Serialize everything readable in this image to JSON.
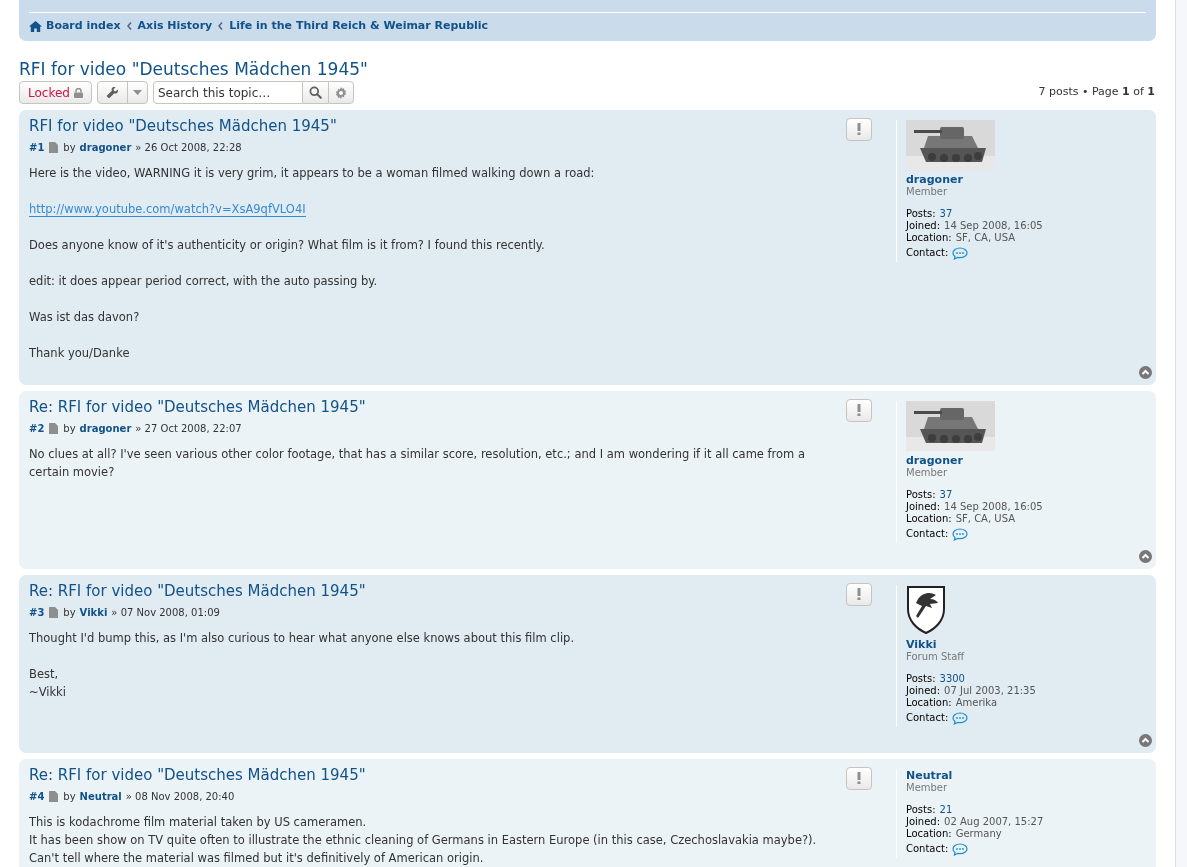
{
  "breadcrumbs": [
    {
      "label": "Board index",
      "icon": true
    },
    {
      "label": "Axis History",
      "icon": false
    },
    {
      "label": "Life in the Third Reich & Weimar Republic",
      "icon": false
    }
  ],
  "topic": {
    "title": "RFI for video \"Deutsches Mädchen 1945\"",
    "locked_label": "Locked",
    "search_placeholder": "Search this topic…",
    "pagination": "7 posts • Page **1** of **1**"
  },
  "posts": [
    {
      "title": "RFI for video \"Deutsches Mädchen 1945\"",
      "number": "#1",
      "by": "by",
      "author": "dragoner",
      "date": "» 26 Oct 2008, 22:28",
      "body": [
        {
          "kind": "text",
          "text": "Here is the video, WARNING it is very grim, it appears to be a woman filmed walking down a road:"
        },
        {
          "kind": "link",
          "text": "http://www.youtube.com/watch?v=XsA9qfVLO4I"
        },
        {
          "kind": "text",
          "text": "Does anyone know of it's authenticity or origin? What film is it from? I found this recently."
        },
        {
          "kind": "text",
          "text": "edit: it does appear period correct, with the auto passing by."
        },
        {
          "kind": "text",
          "text": "Was ist das davon?"
        },
        {
          "kind": "text",
          "text": "Thank you/Danke"
        }
      ],
      "avatar": {
        "kind": "picture"
      },
      "username": "dragoner",
      "rank": "Member",
      "posts_label": "Posts:",
      "posts": "37",
      "joined_label": "Joined:",
      "joined": "14 Sep 2008, 16:05",
      "location_label": "Location:",
      "location": "SF, CA, USA",
      "contact_label": "Contact:"
    },
    {
      "title": "Re: RFI for video \"Deutsches Mädchen 1945\"",
      "number": "#2",
      "by": "by",
      "author": "dragoner",
      "date": "» 27 Oct 2008, 22:07",
      "body": [
        {
          "kind": "text",
          "text": "No clues at all? I've seen various other color footage, that has a similar score, resolution, etc.; and I am wondering if it all came from a certain movie?"
        }
      ],
      "avatar": {
        "kind": "picture"
      },
      "username": "dragoner",
      "rank": "Member",
      "posts_label": "Posts:",
      "posts": "37",
      "joined_label": "Joined:",
      "joined": "14 Sep 2008, 16:05",
      "location_label": "Location:",
      "location": "SF, CA, USA",
      "contact_label": "Contact:"
    },
    {
      "title": "Re: RFI for video \"Deutsches Mädchen 1945\"",
      "number": "#3",
      "by": "by",
      "author": "Vikki",
      "date": "» 07 Nov 2008, 01:09",
      "body": [
        {
          "kind": "text",
          "text": "Thought I'd bump this, as I'm also curious to hear what anyone else knows about this film clip."
        },
        {
          "kind": "lines",
          "lines": [
            "Best,",
            "~Vikki"
          ]
        }
      ],
      "avatar": {
        "kind": "emblem"
      },
      "username": "Vikki",
      "rank": "Forum Staff",
      "posts_label": "Posts:",
      "posts": "3300",
      "joined_label": "Joined:",
      "joined": "07 Jul 2003, 21:35",
      "location_label": "Location:",
      "location": "Amerika",
      "contact_label": "Contact:"
    },
    {
      "title": "Re: RFI for video \"Deutsches Mädchen 1945\"",
      "number": "#4",
      "by": "by",
      "author": "Neutral",
      "date": "» 08 Nov 2008, 20:40",
      "body": [
        {
          "kind": "lines",
          "lines": [
            "This is kodachrome film material taken by US cameramen.",
            "It has been show on TV quite often to illustrate the ethnic cleaning of Germans in Eastern Europe (in this case, Czechoslavakia maybe?). Can't tell where the material was filmed but it's definitively of American origin."
          ]
        }
      ],
      "username": "Neutral",
      "rank": "Member",
      "posts_label": "Posts:",
      "posts": "21",
      "joined_label": "Joined:",
      "joined": "02 Aug 2007, 15:27",
      "location_label": "Location:",
      "location": "Germany",
      "contact_label": "Contact:"
    }
  ]
}
